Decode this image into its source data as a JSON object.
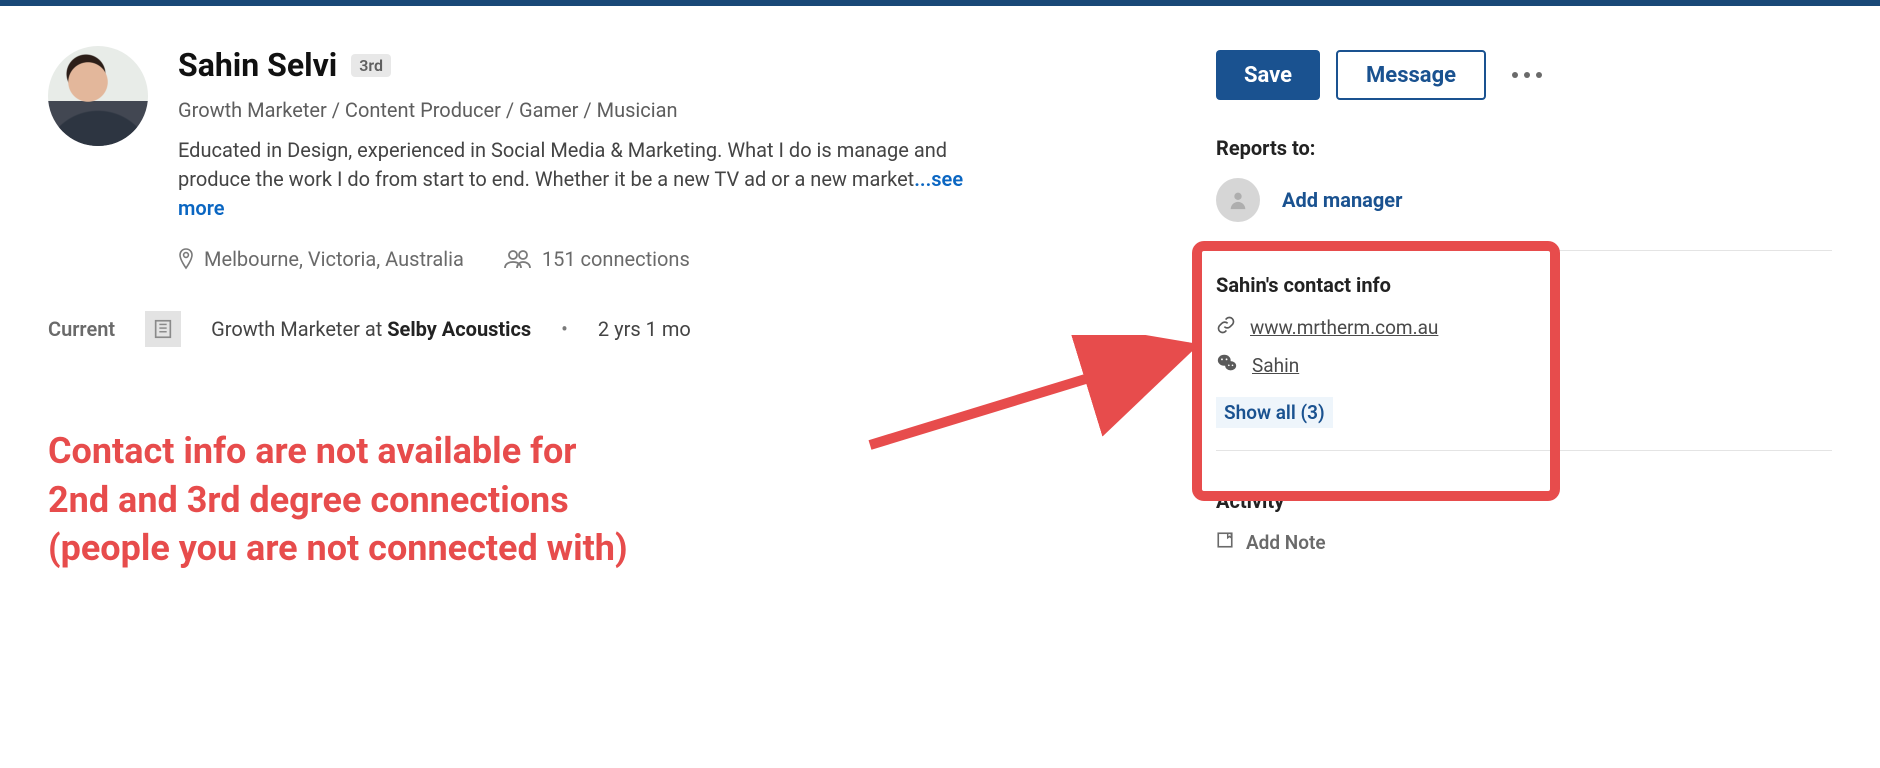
{
  "profile": {
    "name": "Sahin Selvi",
    "degree": "3rd",
    "headline": "Growth Marketer / Content Producer / Gamer / Musician",
    "summary_line1": "Educated in Design, experienced in Social Media & Marketing. What I do is manage and",
    "summary_line2": "produce the work I do from start to end. Whether it be a new TV ad or a new market",
    "see_more": "...see more",
    "location": "Melbourne, Victoria, Australia",
    "connections": "151 connections",
    "current": {
      "label": "Current",
      "title": "Growth Marketer at ",
      "company": "Selby Acoustics",
      "sep": "•",
      "duration": "2 yrs 1 mo"
    }
  },
  "actions": {
    "save": "Save",
    "message": "Message"
  },
  "reports_to": {
    "label": "Reports to:",
    "add_manager": "Add manager"
  },
  "contact": {
    "label": "Sahin's contact info",
    "website": "www.mrtherm.com.au",
    "wechat": "Sahin",
    "show_all": "Show all (3)"
  },
  "activity": {
    "label": "Activity",
    "add_note": "Add Note"
  },
  "annotation": {
    "line1": "Contact info are not available for",
    "line2": "2nd and 3rd degree connections",
    "line3": "(people you are not connected with)"
  }
}
